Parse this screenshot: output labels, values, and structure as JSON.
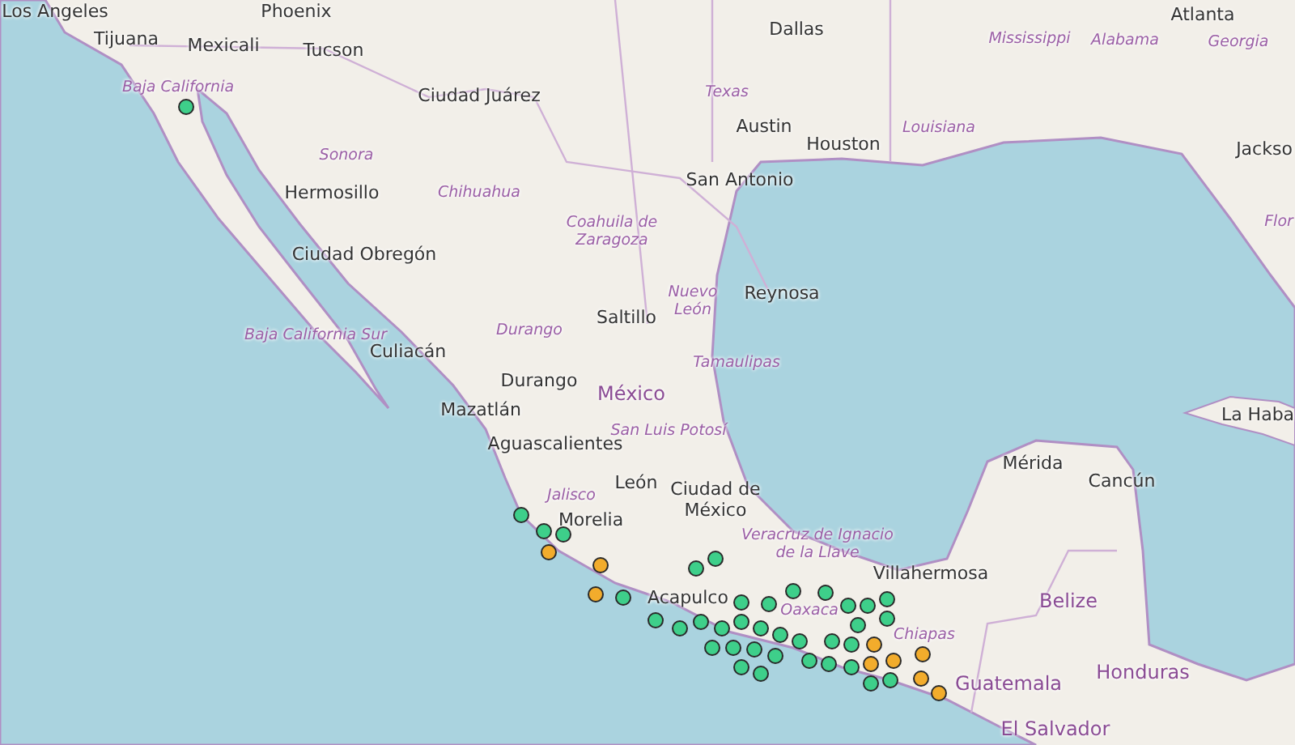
{
  "map": {
    "labels": [
      {
        "text": "Los Angeles",
        "kind": "city"
      },
      {
        "text": "Phoenix",
        "kind": "city"
      },
      {
        "text": "Tijuana",
        "kind": "city"
      },
      {
        "text": "Mexicali",
        "kind": "city"
      },
      {
        "text": "Tucson",
        "kind": "city"
      },
      {
        "text": "Dallas",
        "kind": "city"
      },
      {
        "text": "Atlanta",
        "kind": "city"
      },
      {
        "text": "Mississippi",
        "kind": "region"
      },
      {
        "text": "Alabama",
        "kind": "region"
      },
      {
        "text": "Georgia",
        "kind": "region"
      },
      {
        "text": "Baja California",
        "kind": "region"
      },
      {
        "text": "Ciudad Juárez",
        "kind": "city"
      },
      {
        "text": "Texas",
        "kind": "region"
      },
      {
        "text": "Sonora",
        "kind": "region"
      },
      {
        "text": "Austin",
        "kind": "city"
      },
      {
        "text": "Louisiana",
        "kind": "region"
      },
      {
        "text": "Houston",
        "kind": "city"
      },
      {
        "text": "Jackso",
        "kind": "city"
      },
      {
        "text": "San Antonio",
        "kind": "city"
      },
      {
        "text": "Hermosillo",
        "kind": "city"
      },
      {
        "text": "Chihuahua",
        "kind": "region"
      },
      {
        "text": "Flor",
        "kind": "region"
      },
      {
        "text": "Coahuila de Zaragoza",
        "kind": "region"
      },
      {
        "text": "Ciudad Obregón",
        "kind": "city"
      },
      {
        "text": "Nuevo León",
        "kind": "region"
      },
      {
        "text": "Reynosa",
        "kind": "city"
      },
      {
        "text": "Saltillo",
        "kind": "city"
      },
      {
        "text": "Baja California Sur",
        "kind": "region"
      },
      {
        "text": "Durango",
        "kind": "region"
      },
      {
        "text": "Culiacán",
        "kind": "city"
      },
      {
        "text": "Tamaulipas",
        "kind": "region"
      },
      {
        "text": "Durango",
        "kind": "city"
      },
      {
        "text": "México",
        "kind": "country"
      },
      {
        "text": "Mazatlán",
        "kind": "city"
      },
      {
        "text": "La Haba",
        "kind": "city"
      },
      {
        "text": "San Luis Potosí",
        "kind": "region"
      },
      {
        "text": "Aguascalientes",
        "kind": "city"
      },
      {
        "text": "Mérida",
        "kind": "city"
      },
      {
        "text": "Cancún",
        "kind": "city"
      },
      {
        "text": "León",
        "kind": "city"
      },
      {
        "text": "Jalisco",
        "kind": "region"
      },
      {
        "text": "Morelia",
        "kind": "city"
      },
      {
        "text": "Ciudad de México",
        "kind": "city"
      },
      {
        "text": "Veracruz de Ignacio de la Llave",
        "kind": "region"
      },
      {
        "text": "Villahermosa",
        "kind": "city"
      },
      {
        "text": "Acapulco",
        "kind": "city"
      },
      {
        "text": "Belize",
        "kind": "country"
      },
      {
        "text": "Oaxaca",
        "kind": "region"
      },
      {
        "text": "Chiapas",
        "kind": "region"
      },
      {
        "text": "Honduras",
        "kind": "country"
      },
      {
        "text": "Guatemala",
        "kind": "country"
      },
      {
        "text": "El Salvador",
        "kind": "country"
      }
    ],
    "markers": [
      {
        "color": "#3ecf8a"
      },
      {
        "color": "#3ecf8a"
      },
      {
        "color": "#3ecf8a"
      },
      {
        "color": "#3ecf8a"
      },
      {
        "color": "#f2ac2c"
      },
      {
        "color": "#f2ac2c"
      },
      {
        "color": "#f2ac2c"
      },
      {
        "color": "#3ecf8a"
      },
      {
        "color": "#3ecf8a"
      },
      {
        "color": "#3ecf8a"
      },
      {
        "color": "#3ecf8a"
      },
      {
        "color": "#3ecf8a"
      },
      {
        "color": "#3ecf8a"
      },
      {
        "color": "#3ecf8a"
      },
      {
        "color": "#3ecf8a"
      },
      {
        "color": "#3ecf8a"
      },
      {
        "color": "#3ecf8a"
      },
      {
        "color": "#3ecf8a"
      },
      {
        "color": "#3ecf8a"
      },
      {
        "color": "#3ecf8a"
      },
      {
        "color": "#3ecf8a"
      },
      {
        "color": "#3ecf8a"
      },
      {
        "color": "#3ecf8a"
      },
      {
        "color": "#3ecf8a"
      },
      {
        "color": "#3ecf8a"
      },
      {
        "color": "#3ecf8a"
      },
      {
        "color": "#3ecf8a"
      },
      {
        "color": "#3ecf8a"
      },
      {
        "color": "#3ecf8a"
      },
      {
        "color": "#3ecf8a"
      },
      {
        "color": "#3ecf8a"
      },
      {
        "color": "#3ecf8a"
      },
      {
        "color": "#3ecf8a"
      },
      {
        "color": "#3ecf8a"
      },
      {
        "color": "#3ecf8a"
      },
      {
        "color": "#3ecf8a"
      },
      {
        "color": "#3ecf8a"
      },
      {
        "color": "#3ecf8a"
      },
      {
        "color": "#3ecf8a"
      },
      {
        "color": "#3ecf8a"
      },
      {
        "color": "#f2ac2c"
      },
      {
        "color": "#f2ac2c"
      },
      {
        "color": "#f2ac2c"
      },
      {
        "color": "#f2ac2c"
      },
      {
        "color": "#f2ac2c"
      },
      {
        "color": "#f2ac2c"
      }
    ]
  }
}
